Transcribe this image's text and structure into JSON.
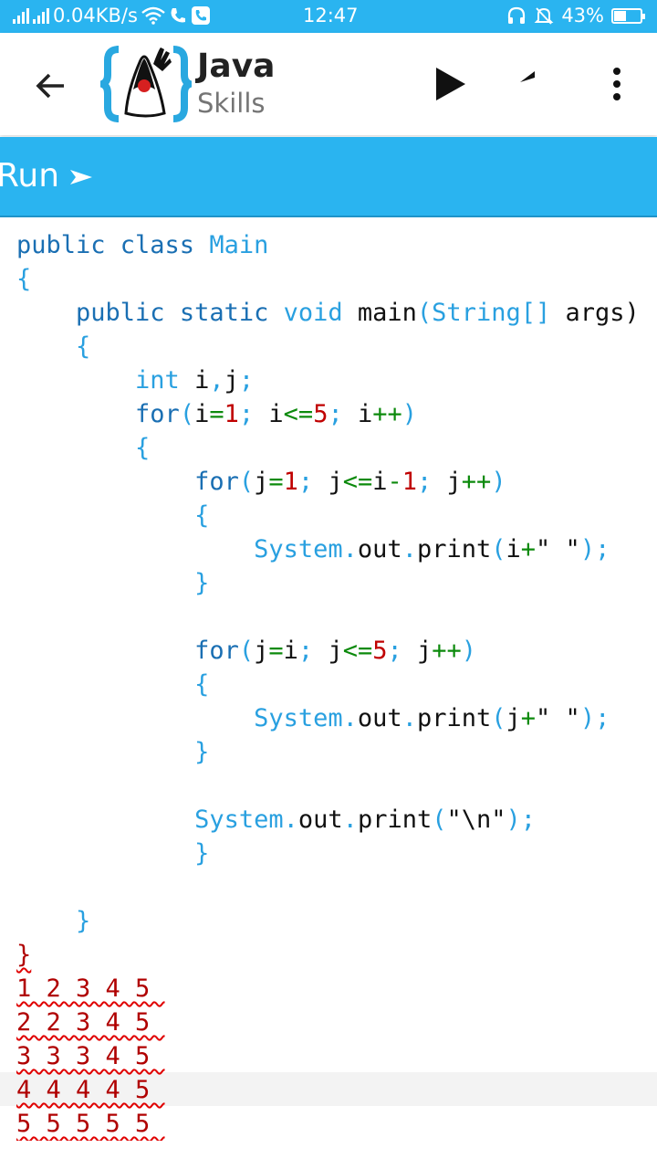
{
  "status_bar": {
    "network_speed": "0.04KB/s",
    "time": "12:47",
    "battery": "43%",
    "battery_level": 0.43,
    "icons": [
      "signal-icon",
      "signal-icon",
      "wifi-icon",
      "call-icon",
      "call-icon",
      "headset-icon",
      "alarm-off-icon",
      "battery-charging-icon"
    ]
  },
  "app_bar": {
    "title": "Java",
    "subtitle": "Skills",
    "back_icon": "arrow-back-icon",
    "actions": [
      "play-icon",
      "undo-icon",
      "more-vert-icon"
    ]
  },
  "run_bar": {
    "label": "Run"
  },
  "colors": {
    "accent": "#2ab4f0",
    "keyword": "#1a6fb3",
    "type": "#29a0e0",
    "number": "#c00000",
    "operator": "#0c8a0c",
    "output_underline": "#e00000"
  },
  "code_lines": [
    {
      "indent": 0,
      "tokens": [
        [
          "public class ",
          "kw"
        ],
        [
          "Main",
          "ty"
        ]
      ]
    },
    {
      "indent": 0,
      "tokens": [
        [
          "{",
          "pu"
        ]
      ]
    },
    {
      "indent": 1,
      "tokens": [
        [
          "public static ",
          "kw"
        ],
        [
          "void ",
          "ty"
        ],
        [
          "main",
          "id"
        ],
        [
          "(String[] ",
          "ty"
        ],
        [
          "args)",
          "id"
        ]
      ]
    },
    {
      "indent": 1,
      "tokens": [
        [
          "{",
          "pu"
        ]
      ]
    },
    {
      "indent": 2,
      "tokens": [
        [
          "int ",
          "ty"
        ],
        [
          "i",
          "id"
        ],
        [
          ",",
          "pu"
        ],
        [
          "j",
          "id"
        ],
        [
          ";",
          "pu"
        ]
      ]
    },
    {
      "indent": 2,
      "tokens": [
        [
          "for",
          "kw"
        ],
        [
          "(",
          "pu"
        ],
        [
          "i",
          "id"
        ],
        [
          "=",
          "op"
        ],
        [
          "1",
          "nu"
        ],
        [
          "; ",
          "pu"
        ],
        [
          "i",
          "id"
        ],
        [
          "<=",
          "op"
        ],
        [
          "5",
          "nu"
        ],
        [
          "; ",
          "pu"
        ],
        [
          "i",
          "id"
        ],
        [
          "++",
          "op"
        ],
        [
          ")",
          "pu"
        ]
      ]
    },
    {
      "indent": 2,
      "tokens": [
        [
          "{",
          "pu"
        ]
      ]
    },
    {
      "indent": 3,
      "tokens": [
        [
          "for",
          "kw"
        ],
        [
          "(",
          "pu"
        ],
        [
          "j",
          "id"
        ],
        [
          "=",
          "op"
        ],
        [
          "1",
          "nu"
        ],
        [
          "; ",
          "pu"
        ],
        [
          "j",
          "id"
        ],
        [
          "<=",
          "op"
        ],
        [
          "i",
          "id"
        ],
        [
          "-",
          "op"
        ],
        [
          "1",
          "nu"
        ],
        [
          "; ",
          "pu"
        ],
        [
          "j",
          "id"
        ],
        [
          "++",
          "op"
        ],
        [
          ")",
          "pu"
        ]
      ]
    },
    {
      "indent": 3,
      "tokens": [
        [
          "{",
          "pu"
        ]
      ]
    },
    {
      "indent": 4,
      "tokens": [
        [
          "System",
          "ty"
        ],
        [
          ".",
          "pu"
        ],
        [
          "out",
          "id"
        ],
        [
          ".",
          "pu"
        ],
        [
          "print",
          "id"
        ],
        [
          "(",
          "pu"
        ],
        [
          "i",
          "id"
        ],
        [
          "+",
          "op"
        ],
        [
          "\" \"",
          "st"
        ],
        [
          ");",
          "pu"
        ]
      ]
    },
    {
      "indent": 3,
      "tokens": [
        [
          "}",
          "pu"
        ]
      ]
    },
    {
      "indent": 0,
      "tokens": []
    },
    {
      "indent": 3,
      "tokens": [
        [
          "for",
          "kw"
        ],
        [
          "(",
          "pu"
        ],
        [
          "j",
          "id"
        ],
        [
          "=",
          "op"
        ],
        [
          "i",
          "id"
        ],
        [
          "; ",
          "pu"
        ],
        [
          "j",
          "id"
        ],
        [
          "<=",
          "op"
        ],
        [
          "5",
          "nu"
        ],
        [
          "; ",
          "pu"
        ],
        [
          "j",
          "id"
        ],
        [
          "++",
          "op"
        ],
        [
          ")",
          "pu"
        ]
      ]
    },
    {
      "indent": 3,
      "tokens": [
        [
          "{",
          "pu"
        ]
      ]
    },
    {
      "indent": 4,
      "tokens": [
        [
          "System",
          "ty"
        ],
        [
          ".",
          "pu"
        ],
        [
          "out",
          "id"
        ],
        [
          ".",
          "pu"
        ],
        [
          "print",
          "id"
        ],
        [
          "(",
          "pu"
        ],
        [
          "j",
          "id"
        ],
        [
          "+",
          "op"
        ],
        [
          "\" \"",
          "st"
        ],
        [
          ");",
          "pu"
        ]
      ]
    },
    {
      "indent": 3,
      "tokens": [
        [
          "}",
          "pu"
        ]
      ]
    },
    {
      "indent": 0,
      "tokens": []
    },
    {
      "indent": 3,
      "tokens": [
        [
          "System",
          "ty"
        ],
        [
          ".",
          "pu"
        ],
        [
          "out",
          "id"
        ],
        [
          ".",
          "pu"
        ],
        [
          "print",
          "id"
        ],
        [
          "(",
          "pu"
        ],
        [
          "\"\\n\"",
          "st"
        ],
        [
          ");",
          "pu"
        ]
      ]
    },
    {
      "indent": 3,
      "tokens": [
        [
          "}",
          "pu"
        ]
      ]
    },
    {
      "indent": 0,
      "tokens": []
    },
    {
      "indent": 1,
      "tokens": [
        [
          "}",
          "pu"
        ]
      ]
    },
    {
      "indent": 0,
      "tokens": [
        [
          "}",
          "ot"
        ]
      ]
    }
  ],
  "output_lines": [
    "1 2 3 4 5 ",
    "2 2 3 4 5 ",
    "3 3 3 4 5 ",
    "4 4 4 4 5 ",
    "5 5 5 5 5 "
  ]
}
